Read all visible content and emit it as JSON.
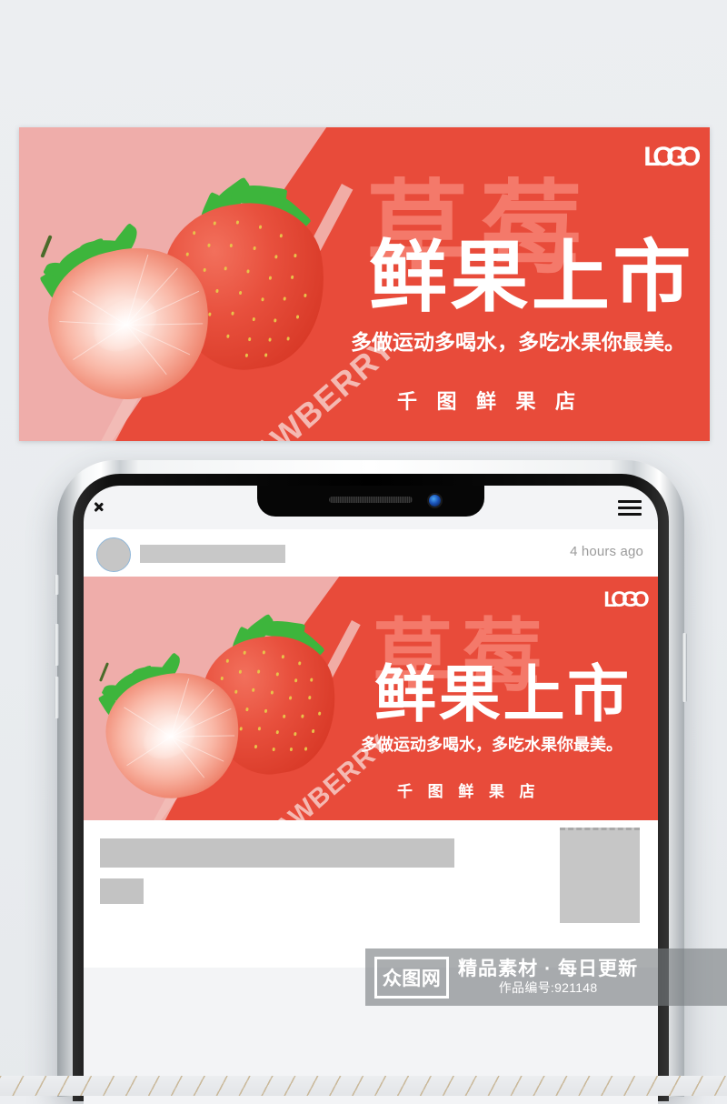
{
  "meta": {
    "background_color": "#e9ecef",
    "brand_red": "#e84b3a",
    "brand_pink": "#efadaa",
    "ghost_red": "#f4796a",
    "watermark_pink": "#f6c3bd"
  },
  "poster": {
    "logo": "LOGO",
    "ghost_watermark": "草莓",
    "diagonal_watermark": "STRAWBERRY",
    "headline": "鲜果上市",
    "subline": "多做运动多喝水，多吃水果你最美。",
    "shop_name": "千 图 鲜 果 店"
  },
  "phone": {
    "post": {
      "time_ago": "4 hours ago"
    },
    "banner": {
      "logo": "LOGO",
      "ghost_watermark": "草莓",
      "diagonal_watermark": "STRAWBERRY",
      "headline": "鲜果上市",
      "subline": "多做运动多喝水，多吃水果你最美。",
      "shop_name": "千 图 鲜 果 店"
    }
  },
  "watermark": {
    "logo_text": "众图网",
    "tagline": "精品素材 · 每日更新",
    "work_id": "作品编号:921148"
  }
}
